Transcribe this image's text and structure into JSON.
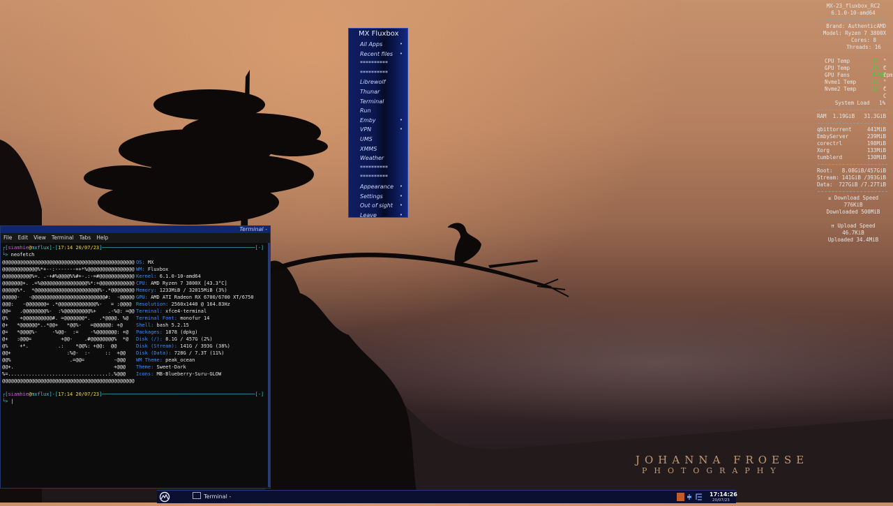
{
  "menu": {
    "title": "MX Fluxbox",
    "items": [
      {
        "label": "All Apps",
        "sub": true
      },
      {
        "label": "Recent files",
        "sub": true
      },
      {
        "label": "**********",
        "sub": false
      },
      {
        "label": "**********",
        "sub": false
      },
      {
        "label": "Librewolf",
        "sub": false
      },
      {
        "label": "Thunar",
        "sub": false
      },
      {
        "label": "Terminal",
        "sub": false
      },
      {
        "label": "Run",
        "sub": false
      },
      {
        "label": "Emby",
        "sub": true
      },
      {
        "label": "VPN",
        "sub": true
      },
      {
        "label": "UMS",
        "sub": false
      },
      {
        "label": "XMMS",
        "sub": false
      },
      {
        "label": "Weather",
        "sub": false
      },
      {
        "label": "**********",
        "sub": false
      },
      {
        "label": "**********",
        "sub": false
      },
      {
        "label": "Appearance",
        "sub": true
      },
      {
        "label": "Settings",
        "sub": true
      },
      {
        "label": "Out of sight",
        "sub": true
      },
      {
        "label": "Leave",
        "sub": true
      }
    ],
    "submenu_glyph": "•"
  },
  "conky": {
    "header1": "MX-23_fluxbox_RC2",
    "header2": "6.1.0-10-amd64",
    "brand": "Brand: AuthenticAMD",
    "model": "Model: Ryzen 7 3800X",
    "cores": "Cores: 8",
    "threads": "Threads: 16",
    "temps": [
      {
        "label": "CPU Temp",
        "value": "42",
        "unit": "° C"
      },
      {
        "label": "GPU Temp",
        "value": "46",
        "unit": "° C"
      },
      {
        "label": "GPU Fans",
        "value": "1450",
        "unit": "rpm"
      },
      {
        "label": "Nvme1 Temp",
        "value": "47",
        "unit": "° C"
      },
      {
        "label": "Nvme2 Temp",
        "value": "47",
        "unit": "° C"
      }
    ],
    "load_label": "System Load",
    "load_value": "1%",
    "ram_label": "RAM",
    "ram_used": "1.19GiB",
    "ram_total": "31.3GiB",
    "procs": [
      {
        "name": "qbittorrent",
        "mem": "441MiB"
      },
      {
        "name": "EmbyServer",
        "mem": "239MiB"
      },
      {
        "name": "corectrl",
        "mem": "198MiB"
      },
      {
        "name": "Xorg",
        "mem": "133MiB"
      },
      {
        "name": "tumblerd",
        "mem": "130MiB"
      }
    ],
    "disks": [
      {
        "label": "Root:",
        "value": "8.08GiB/457GiB"
      },
      {
        "label": "Stream:",
        "value": "141GiB /393GiB"
      },
      {
        "label": "Data:",
        "value": "727GiB /7.27TiB"
      }
    ],
    "dl_label": "⇊ Download Speed",
    "dl_speed": "776KiB",
    "dl_total": "Downloaded 500MiB",
    "ul_label": "⇈ Upload Speed",
    "ul_speed": "46.7KiB",
    "ul_total": "Uploaded 34.4MiB"
  },
  "terminal": {
    "title": "Terminal -",
    "menu": [
      "File",
      "Edit",
      "View",
      "Terminal",
      "Tabs",
      "Help"
    ],
    "user": "siamhie",
    "host": "mxflux",
    "time": "17:14 20/07/23",
    "command": "neofetch",
    "neofetch": [
      {
        "k": "OS",
        "v": "MX"
      },
      {
        "k": "WM",
        "v": "Fluxbox"
      },
      {
        "k": "Kernel",
        "v": "6.1.0-10-amd64"
      },
      {
        "k": "CPU",
        "v": "AMD Ryzen 7 3800X [43.3°C]"
      },
      {
        "k": "Memory",
        "v": "1233MiB / 32015MiB (3%)"
      },
      {
        "k": "GPU",
        "v": "AMD ATI Radeon RX 6700/6700 XT/6750"
      },
      {
        "k": "Resolution",
        "v": "2560x1440 @ 164.83Hz"
      },
      {
        "k": "Terminal",
        "v": "xfce4-terminal"
      },
      {
        "k": "Terminal Font",
        "v": "monofur 14"
      },
      {
        "k": "Shell",
        "v": "bash 5.2.15"
      },
      {
        "k": "Packages",
        "v": "1878 (dpkg)"
      },
      {
        "k": "Disk (/)",
        "v": "8.1G / 457G (2%)"
      },
      {
        "k": "Disk (Stream)",
        "v": "141G / 393G (38%)"
      },
      {
        "k": "Disk (Data)",
        "v": "728G / 7.3T (11%)"
      },
      {
        "k": "WM Theme",
        "v": "peak_ocean"
      },
      {
        "k": "Theme",
        "v": "Sweet-Dark"
      },
      {
        "k": "Icons",
        "v": "MB-Blueberry-Suru-GLOW"
      }
    ],
    "logo": [
      "@@@@@@@@@@@@@@@@@@@@@@@@@@@@@@@@@@@@@@@@@@@@@",
      "@@@@@@@@@@@@%*+--:-------=+*%@@@@@@@@@@@@@@@@",
      "@@@@@@@@@@%=. .-+#%@@@@%%#+-.:-=#@@@@@@@@@@@@",
      "@@@@@@@+. .=%@@@@@@@@@@@@@@@@%*:+@@@@@@@@@@@@",
      "@@@@@%*.  *@@@@@@@@@@@@@@@@@@@@@@%-.*@@@@@@@@",
      "@@@@@-   -@@@@@@@@@@@@@@@@@@@@@@@@@#:  -@@@@@",
      "@@@:   -@@@@@@@= .*@@@@@@@@@@@@@%-   = :@@@@",
      "@@=   .@@@@@@@@%-  :%@@@@@@@@@%+    .-%@: =@@",
      "@%    +@@@@@@@@@@#. =@@@@@@@*.   .*@@@@. %@",
      "@+   *@@@@@@*..*@@+   *@@%-   =@@@@@@: +@",
      "@=   *@@@@%-     -%@@-  :=    -%@@@@@@@: +@",
      "@+   :@@@=          +@@-    .#@@@@@@@@%  *@",
      "@%    +*.          .:    *@@%: +@@:  @@",
      "@@+                   :%@-  :-     ::  +@@",
      "@@%                    .=@@=          -@@@",
      "@@+.                                  +@@@",
      "%=..................................:.%@@@",
      "@@@@@@@@@@@@@@@@@@@@@@@@@@@@@@@@@@@@@@@@@@@@@"
    ]
  },
  "taskbar": {
    "task_label": "Terminal -",
    "clock": "17:14:26",
    "date": "20/07/23"
  },
  "watermark": {
    "line1": "JOHANNA FROESE",
    "line2": "PHOTOGRAPHY"
  }
}
